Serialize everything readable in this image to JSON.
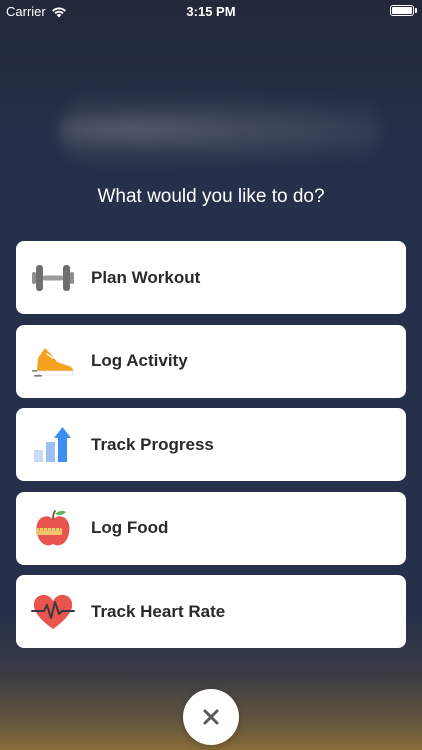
{
  "status_bar": {
    "carrier": "Carrier",
    "time": "3:15 PM"
  },
  "prompt": "What would you like to do?",
  "menu": {
    "items": [
      {
        "label": "Plan Workout",
        "icon": "dumbbell-icon"
      },
      {
        "label": "Log Activity",
        "icon": "sneaker-icon"
      },
      {
        "label": "Track Progress",
        "icon": "progress-chart-icon"
      },
      {
        "label": "Log Food",
        "icon": "apple-icon"
      },
      {
        "label": "Track Heart Rate",
        "icon": "heart-rate-icon"
      }
    ]
  },
  "close": {
    "icon": "close-icon"
  },
  "colors": {
    "background": "#27304a",
    "card": "#ffffff",
    "text_dark": "#2a2a2a",
    "accent_orange": "#f5a11c",
    "accent_blue": "#3b8ff0",
    "accent_red": "#e8554e"
  }
}
